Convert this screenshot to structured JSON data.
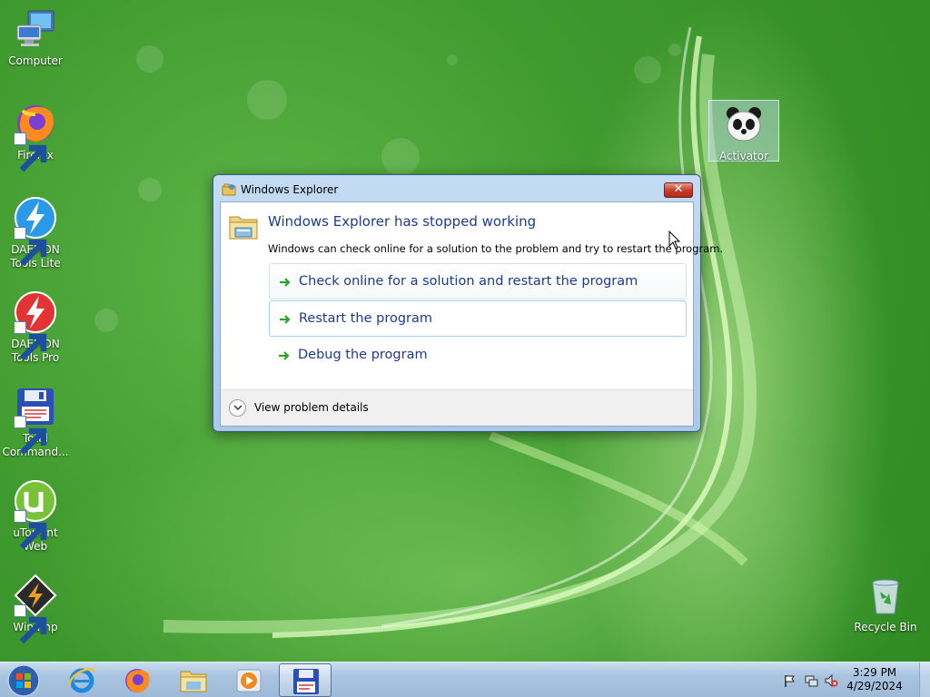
{
  "desktop": {
    "icons": [
      {
        "label": "Computer"
      },
      {
        "label": "Firefox"
      },
      {
        "label": "DAEMON Tools Lite"
      },
      {
        "label": "DAEMON Tools Pro"
      },
      {
        "label": "Total Command..."
      },
      {
        "label": "uTorrent Web"
      },
      {
        "label": "Winamp"
      },
      {
        "label": "Activator"
      },
      {
        "label": "Recycle Bin"
      }
    ]
  },
  "dialog": {
    "title": "Windows Explorer",
    "close_glyph": "✕",
    "heading": "Windows Explorer has stopped working",
    "message": "Windows can check online for a solution to the problem and try to restart the program.",
    "options": [
      {
        "label": "Check online for a solution and restart the program"
      },
      {
        "label": "Restart the program"
      },
      {
        "label": "Debug the program"
      }
    ],
    "details_label": "View problem details"
  },
  "taskbar": {
    "pinned": [
      "start-orb-icon",
      "internet-explorer-icon",
      "firefox-icon",
      "file-explorer-icon",
      "media-player-icon",
      "total-commander-icon"
    ],
    "clock": {
      "time": "3:29 PM",
      "date": "4/29/2024"
    }
  },
  "colors": {
    "heading_blue": "#1d3b8c",
    "desktop_green": "#3f9a2e",
    "command_arrow": "#2fa12f"
  }
}
